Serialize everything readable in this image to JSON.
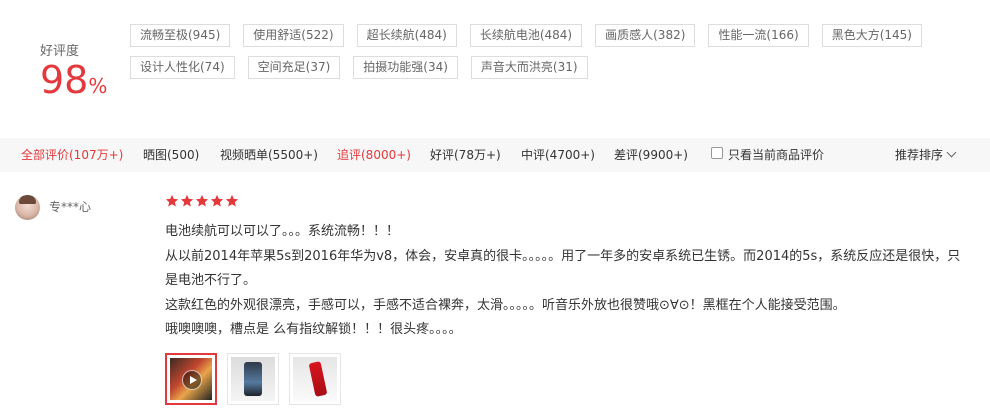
{
  "rating": {
    "label": "好评度",
    "value": "98",
    "unit": "%"
  },
  "tags": [
    [
      "流畅至极(945)",
      "使用舒适(522)",
      "超长续航(484)",
      "长续航电池(484)",
      "画质感人(382)",
      "性能一流(166)",
      "黑色大方(145)"
    ],
    [
      "设计人性化(74)",
      "空间充足(37)",
      "拍摄功能强(34)",
      "声音大而洪亮(31)"
    ]
  ],
  "filters": {
    "all": "全部评价(107万+)",
    "photo": "晒图(500)",
    "video": "视频晒单(5500+)",
    "append": "追评(8000+)",
    "good": "好评(78万+)",
    "medium": "中评(4700+)",
    "bad": "差评(9900+)",
    "only_current": "只看当前商品评价",
    "sort": "推荐排序"
  },
  "review": {
    "username": "专***心",
    "stars": 5,
    "lines": [
      "电池续航可以可以了。。。系统流畅！！！",
      "从以前2014年苹果5s到2016年华为v8，体会，安卓真的很卡。。。。。用了一年多的安卓系统已生锈。而2014的5s，系统反应还是很快，只是电池不行了。",
      "这款红色的外观很漂亮，手感可以，手感不适合裸奔，太滑。。。。。听音乐外放也很赞哦⊙∀⊙！黑框在个人能接受范围。",
      "哦噢噢噢，槽点是 么有指纹解锁！！！很头疼。。。。"
    ]
  },
  "colors": {
    "accent": "#e4393c",
    "filter_bg": "#f7f7f7"
  },
  "icons": {
    "star": "star-icon",
    "play": "play-icon",
    "caret": "chevron-down-icon"
  }
}
